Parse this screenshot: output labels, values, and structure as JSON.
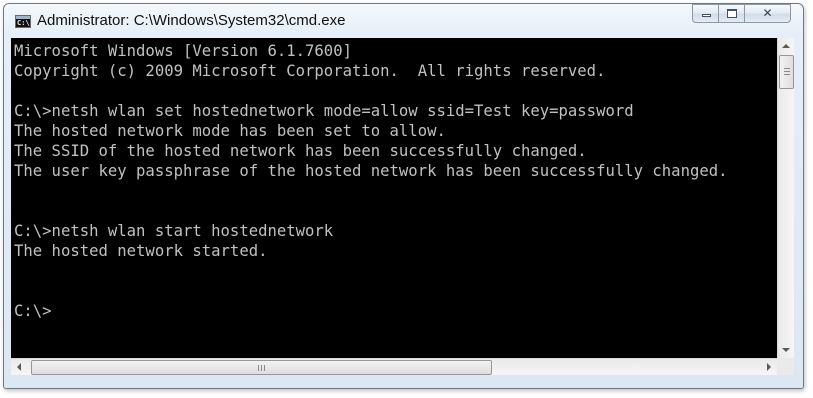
{
  "window": {
    "title": "Administrator: C:\\Windows\\System32\\cmd.exe",
    "icon": "cmd-prompt-icon",
    "icon_text": "C:\\",
    "controls": {
      "minimize": "minimize-icon",
      "maximize": "maximize-icon",
      "close": "close-icon",
      "close_glyph": "✕"
    }
  },
  "console": {
    "background": "#000000",
    "foreground": "#c0c0c0",
    "lines": [
      "Microsoft Windows [Version 6.1.7600]",
      "Copyright (c) 2009 Microsoft Corporation.  All rights reserved.",
      "",
      "C:\\>netsh wlan set hostednetwork mode=allow ssid=Test key=password",
      "The hosted network mode has been set to allow.",
      "The SSID of the hosted network has been successfully changed.",
      "The user key passphrase of the hosted network has been successfully changed.",
      "",
      "",
      "C:\\>netsh wlan start hostednetwork",
      "The hosted network started.",
      "",
      "",
      "C:\\>"
    ]
  },
  "scrollbars": {
    "vertical": {
      "up": "scroll-up-arrow-icon",
      "down": "scroll-down-arrow-icon"
    },
    "horizontal": {
      "left": "scroll-left-arrow-icon",
      "right": "scroll-right-arrow-icon"
    }
  }
}
